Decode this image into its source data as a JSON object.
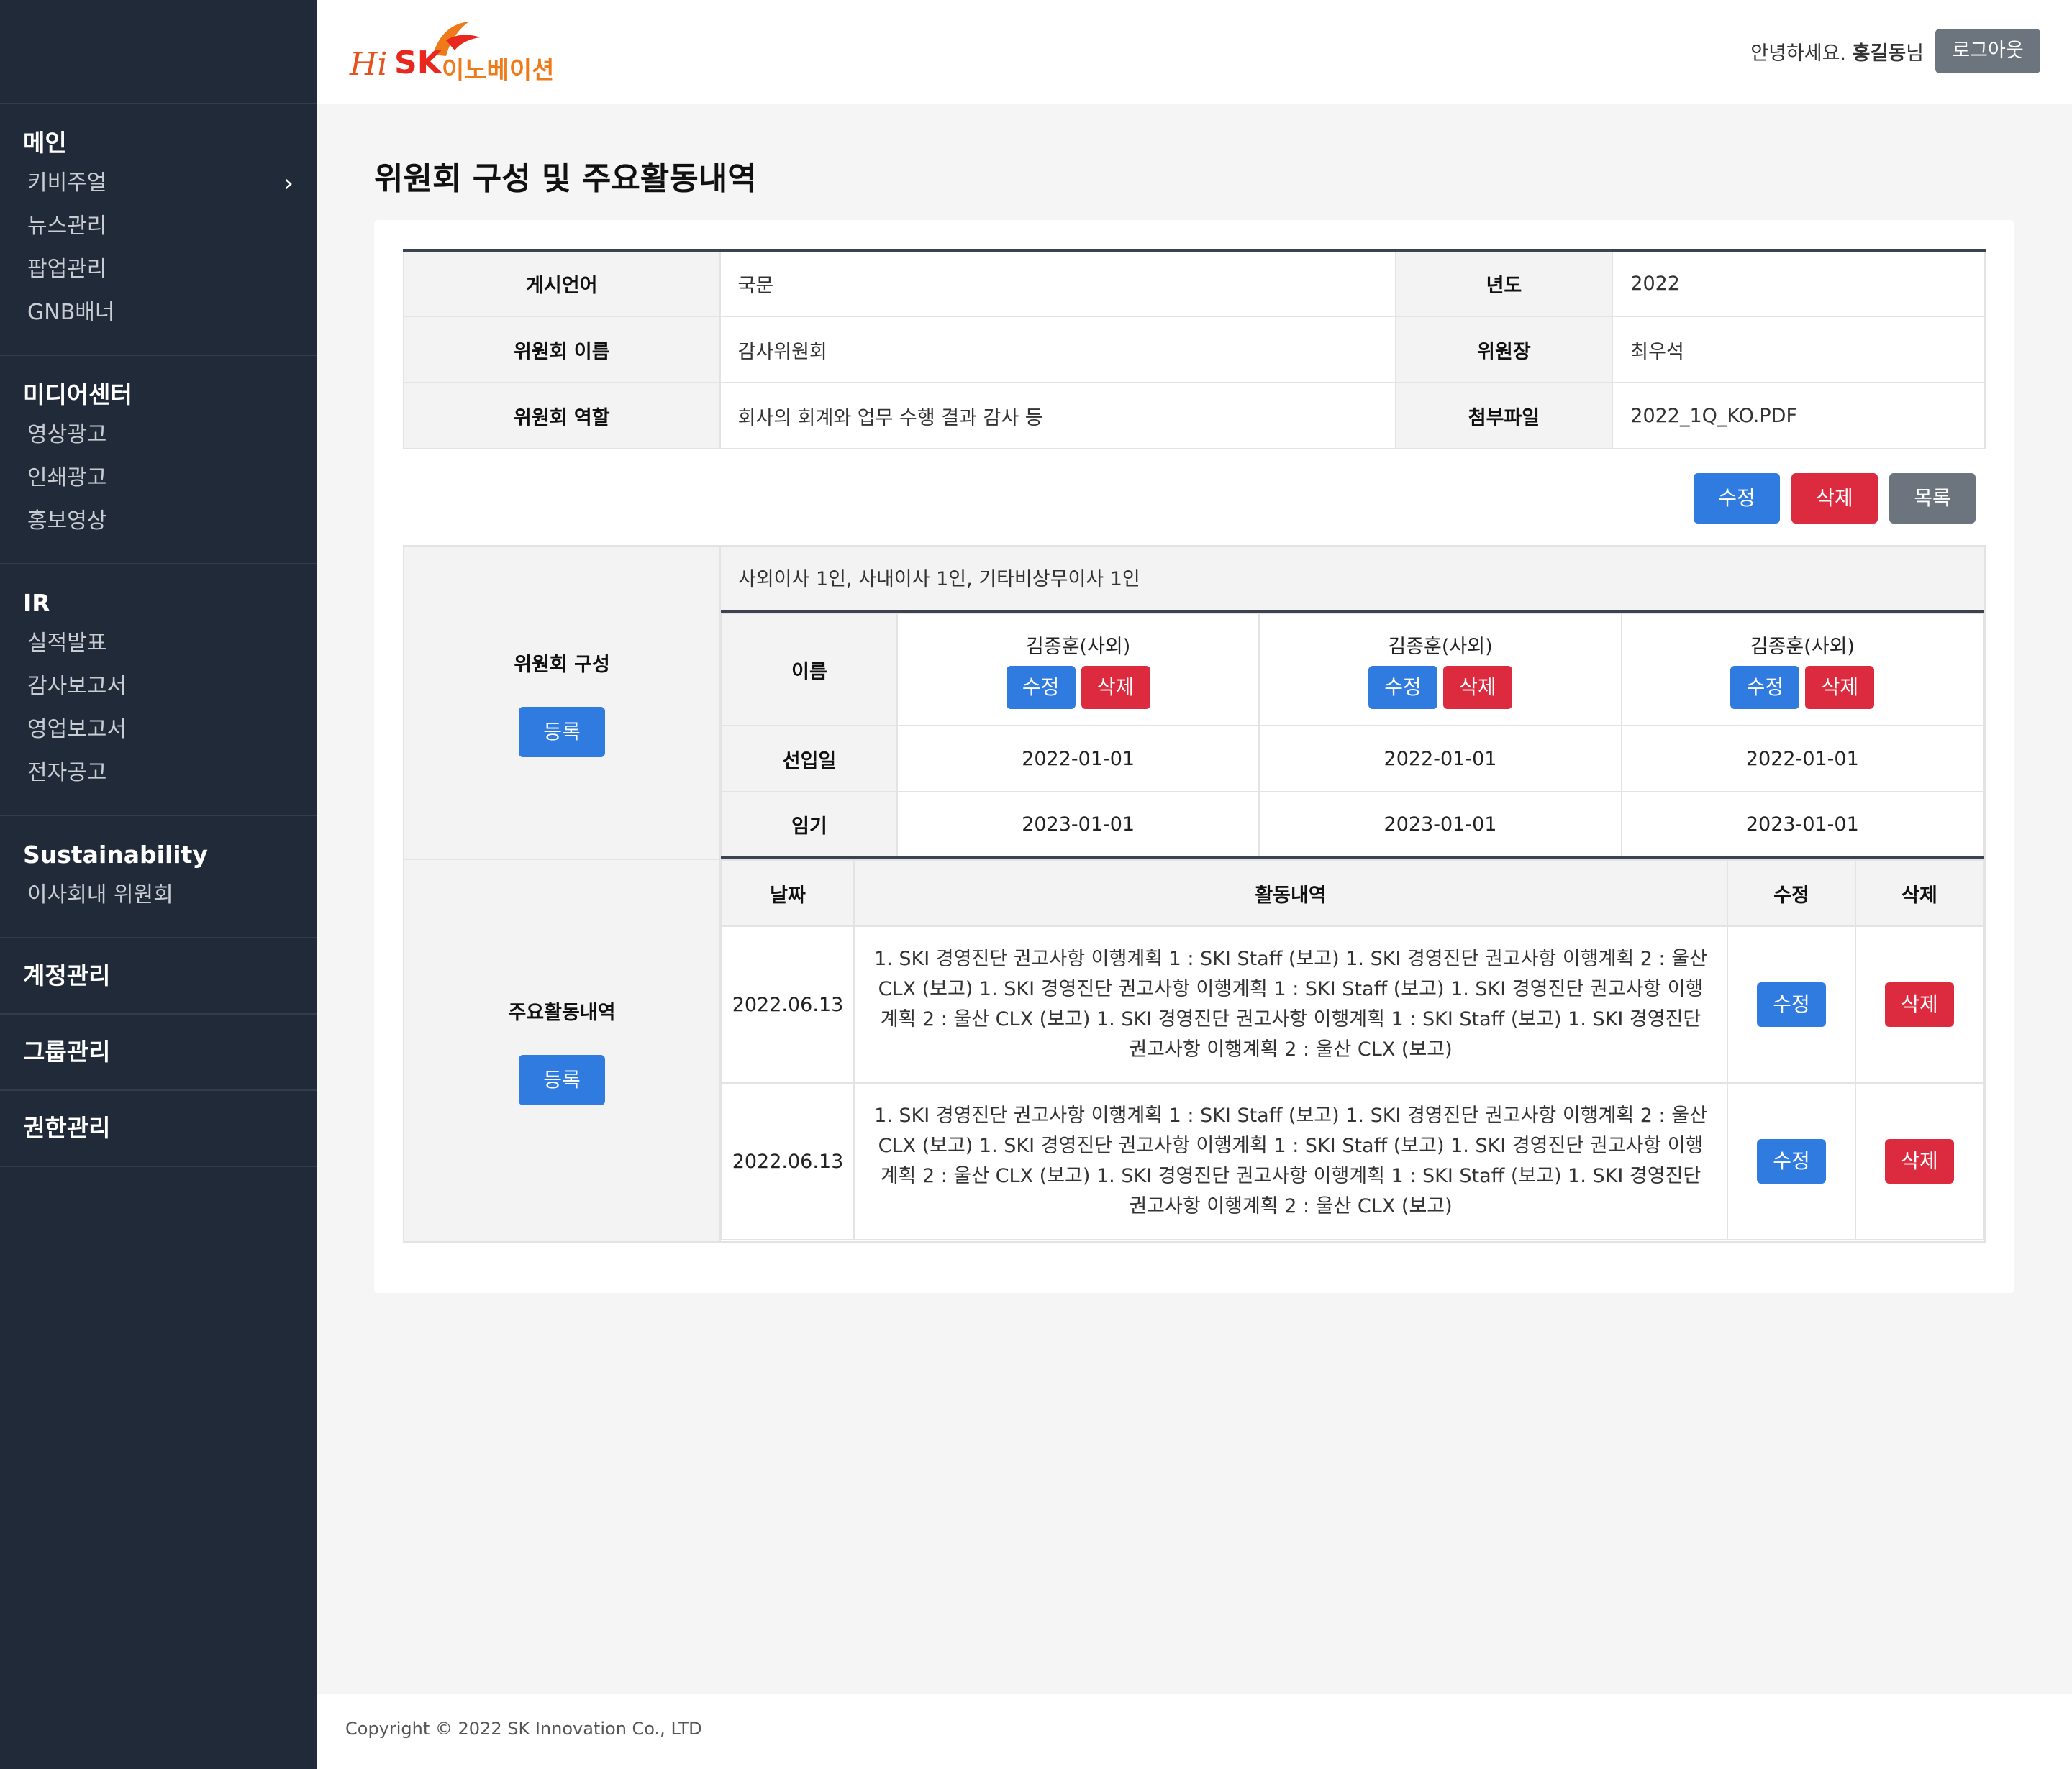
{
  "header": {
    "logo": {
      "hi": "Hi",
      "sk": "SK",
      "kor": "이노베이션"
    },
    "greeting_prefix": "안녕하세요.",
    "user_name": "홍길동",
    "greeting_suffix": "님",
    "logout_label": "로그아웃"
  },
  "sidebar": {
    "sections": [
      {
        "title": "메인",
        "items": [
          "키비주얼",
          "뉴스관리",
          "팝업관리",
          "GNB배너"
        ]
      },
      {
        "title": "미디어센터",
        "items": [
          "영상광고",
          "인쇄광고",
          "홍보영상"
        ]
      },
      {
        "title": "IR",
        "items": [
          "실적발표",
          "감사보고서",
          "영업보고서",
          "전자공고"
        ]
      },
      {
        "title": "Sustainability",
        "items": [
          "이사회내 위원회"
        ]
      },
      {
        "title": "계정관리",
        "items": []
      },
      {
        "title": "그룹관리",
        "items": []
      },
      {
        "title": "권한관리",
        "items": []
      }
    ]
  },
  "page": {
    "title": "위원회 구성 및 주요활동내역"
  },
  "info": {
    "lang_label": "게시언어",
    "lang_value": "국문",
    "year_label": "년도",
    "year_value": "2022",
    "name_label": "위원회 이름",
    "name_value": "감사위원회",
    "chair_label": "위원장",
    "chair_value": "최우석",
    "role_label": "위원회 역할",
    "role_value": "회사의 회계와 업무 수행 결과 감사 등",
    "file_label": "첨부파일",
    "file_value": "2022_1Q_KO.PDF"
  },
  "buttons": {
    "edit": "수정",
    "delete": "삭제",
    "list": "목록",
    "register": "등록"
  },
  "composition": {
    "label": "위원회 구성",
    "summary": "사외이사 1인, 사내이사 1인, 기타비상무이사 1인",
    "row_labels": {
      "name": "이름",
      "appointed": "선입일",
      "term": "임기"
    },
    "members": [
      {
        "name": "김종훈(사외)",
        "appointed": "2022-01-01",
        "term": "2023-01-01"
      },
      {
        "name": "김종훈(사외)",
        "appointed": "2022-01-01",
        "term": "2023-01-01"
      },
      {
        "name": "김종훈(사외)",
        "appointed": "2022-01-01",
        "term": "2023-01-01"
      }
    ]
  },
  "activities": {
    "label": "주요활동내역",
    "headers": {
      "date": "날짜",
      "content": "활동내역",
      "edit": "수정",
      "delete": "삭제"
    },
    "rows": [
      {
        "date": "2022.06.13",
        "content": "1. SKI 경영진단 권고사항 이행계획 1 : SKI Staff (보고) 1. SKI 경영진단 권고사항 이행계획 2 : 울산 CLX (보고) 1. SKI 경영진단 권고사항 이행계획 1 : SKI Staff (보고) 1. SKI 경영진단 권고사항 이행계획 2 : 울산 CLX (보고) 1. SKI 경영진단 권고사항 이행계획 1 : SKI Staff (보고) 1. SKI 경영진단 권고사항 이행계획 2 : 울산 CLX (보고)"
      },
      {
        "date": "2022.06.13",
        "content": "1. SKI 경영진단 권고사항 이행계획 1 : SKI Staff (보고) 1. SKI 경영진단 권고사항 이행계획 2 : 울산 CLX (보고) 1. SKI 경영진단 권고사항 이행계획 1 : SKI Staff (보고) 1. SKI 경영진단 권고사항 이행계획 2 : 울산 CLX (보고) 1. SKI 경영진단 권고사항 이행계획 1 : SKI Staff (보고) 1. SKI 경영진단 권고사항 이행계획 2 : 울산 CLX (보고)"
      }
    ]
  },
  "footer": {
    "copyright": "Copyright © 2022 SK Innovation Co., LTD"
  },
  "colors": {
    "sidebar": "#212a39",
    "primary": "#2f7be0",
    "danger": "#dc2a3f",
    "secondary": "#6c757d",
    "brand": "#e8281e"
  }
}
